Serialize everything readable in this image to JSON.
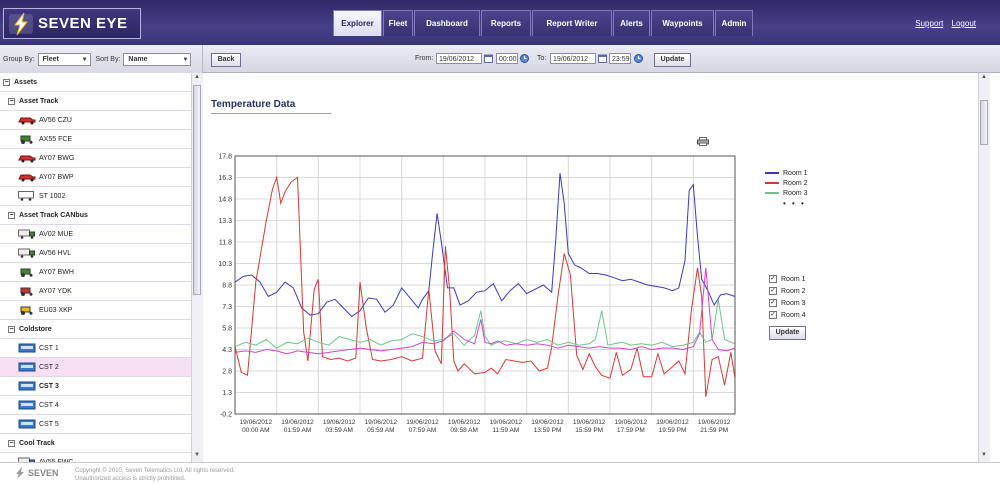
{
  "app": {
    "brand": "SEVEN EYE",
    "nav": [
      "Explorer",
      "Fleet",
      "Dashboard",
      "Reports",
      "Report Writer",
      "Alerts",
      "Waypoints",
      "Admin"
    ],
    "active_tab": "Explorer",
    "links": {
      "support": "Support",
      "logout": "Logout"
    }
  },
  "sidebar": {
    "group_by_label": "Group By:",
    "group_by_value": "Fleet",
    "sort_by_label": "Sort By:",
    "sort_by_value": "Name",
    "tree": [
      {
        "kind": "root",
        "label": "Assets"
      },
      {
        "kind": "group",
        "label": "Asset Track"
      },
      {
        "kind": "item",
        "label": "AV56 CZU",
        "icon": "red-car-icon"
      },
      {
        "kind": "item",
        "label": "AX55 FCE",
        "icon": "green-tractor-icon"
      },
      {
        "kind": "item",
        "label": "AY07 BWG",
        "icon": "red-car-icon"
      },
      {
        "kind": "item",
        "label": "AY07 BWP",
        "icon": "red-car-icon"
      },
      {
        "kind": "item",
        "label": "ST 1002",
        "icon": "trailer-icon"
      },
      {
        "kind": "group",
        "label": "Asset Track CANbus"
      },
      {
        "kind": "item",
        "label": "AV02 MUE",
        "icon": "green-truck-icon"
      },
      {
        "kind": "item",
        "label": "AV56 HVL",
        "icon": "green-truck-icon"
      },
      {
        "kind": "item",
        "label": "AY07 BWH",
        "icon": "green-tractor-icon"
      },
      {
        "kind": "item",
        "label": "AY07 YDK",
        "icon": "red-tractor-icon"
      },
      {
        "kind": "item",
        "label": "EU03 XKP",
        "icon": "yellow-digger-icon"
      },
      {
        "kind": "group",
        "label": "Coldstore"
      },
      {
        "kind": "item",
        "label": "CST 1",
        "icon": "coldstore-icon"
      },
      {
        "kind": "item",
        "label": "CST 2",
        "icon": "coldstore-icon",
        "selected": true
      },
      {
        "kind": "item",
        "label": "CST 3",
        "icon": "coldstore-icon",
        "bold": true
      },
      {
        "kind": "item",
        "label": "CST 4",
        "icon": "coldstore-icon"
      },
      {
        "kind": "item",
        "label": "CST 5",
        "icon": "coldstore-icon"
      },
      {
        "kind": "group",
        "label": "Cool Track"
      },
      {
        "kind": "item",
        "label": "AV55 FWC",
        "icon": "blue-truck-icon"
      }
    ]
  },
  "toolbar": {
    "back_label": "Back",
    "from_label": "From:",
    "from_date": "19/06/2012",
    "from_time": "00:00",
    "to_label": "To:",
    "to_date": "19/06/2012",
    "to_time": "23:59",
    "update_label": "Update"
  },
  "panel": {
    "title": "Temperature Data",
    "rooms": [
      {
        "label": "Room 1",
        "checked": true
      },
      {
        "label": "Room 2",
        "checked": true
      },
      {
        "label": "Room 3",
        "checked": true
      },
      {
        "label": "Room 4",
        "checked": true
      }
    ],
    "update_label": "Update",
    "legend_more": "• • •"
  },
  "chart_data": {
    "type": "line",
    "title": "",
    "xlabel": "",
    "ylabel": "",
    "ylim": [
      -0.2,
      17.8
    ],
    "yticks": [
      "17.8",
      "16.3",
      "14.8",
      "13.3",
      "11.8",
      "10.3",
      "8.8",
      "7.3",
      "5.8",
      "4.3",
      "2.8",
      "1.3",
      "-0.2"
    ],
    "xlim_hours": [
      0,
      24
    ],
    "x_tick_labels": [
      [
        "19/06/2012",
        "00:00 AM"
      ],
      [
        "19/06/2012",
        "01:59 AM"
      ],
      [
        "19/06/2012",
        "03:59 AM"
      ],
      [
        "19/06/2012",
        "05:59 AM"
      ],
      [
        "19/06/2012",
        "07:59 AM"
      ],
      [
        "19/06/2012",
        "09:58 AM"
      ],
      [
        "19/06/2012",
        "11:59 AM"
      ],
      [
        "19/06/2012",
        "13:59 PM"
      ],
      [
        "19/06/2012",
        "15:59 PM"
      ],
      [
        "19/06/2012",
        "17:59 PM"
      ],
      [
        "19/06/2012",
        "19:59 PM"
      ],
      [
        "19/06/2012",
        "21:59 PM"
      ]
    ],
    "grid": true,
    "legend_position": "right",
    "series": [
      {
        "name": "Room 1",
        "color": "#3b3bb8",
        "x": [
          0,
          0.4,
          0.8,
          1.2,
          1.6,
          2.0,
          2.4,
          2.8,
          3.2,
          3.6,
          4.0,
          4.4,
          4.8,
          5.2,
          5.6,
          6.0,
          6.4,
          6.8,
          7.2,
          7.6,
          8.0,
          8.4,
          8.8,
          9.0,
          9.3,
          9.5,
          9.7,
          9.9,
          10.2,
          10.5,
          10.8,
          11.2,
          11.6,
          12.0,
          12.4,
          12.8,
          13.2,
          13.6,
          14.0,
          14.4,
          14.8,
          15.2,
          15.4,
          15.6,
          15.8,
          16.0,
          16.3,
          16.6,
          17.0,
          17.4,
          17.8,
          18.2,
          18.6,
          19.0,
          19.4,
          19.8,
          20.2,
          20.6,
          21.0,
          21.3,
          21.6,
          21.8,
          22.0,
          22.2,
          22.4,
          22.7,
          23.0,
          23.3,
          23.6,
          24.0
        ],
        "y": [
          9.0,
          9.4,
          9.5,
          9.0,
          8.0,
          8.3,
          9.0,
          8.6,
          7.2,
          6.7,
          6.8,
          7.6,
          7.8,
          7.2,
          6.6,
          7.0,
          7.9,
          7.8,
          6.9,
          7.4,
          8.6,
          7.9,
          7.2,
          7.8,
          8.4,
          11.2,
          13.8,
          11.8,
          8.6,
          8.6,
          7.4,
          7.7,
          8.3,
          8.4,
          8.9,
          7.7,
          8.4,
          8.9,
          8.2,
          8.5,
          8.8,
          8.3,
          12.0,
          16.6,
          14.5,
          11.0,
          10.2,
          10.0,
          9.6,
          9.6,
          9.5,
          9.3,
          9.1,
          9.2,
          9.0,
          8.8,
          8.7,
          8.6,
          8.4,
          8.6,
          10.5,
          15.4,
          15.8,
          12.2,
          9.2,
          8.4,
          7.4,
          8.1,
          8.2,
          8.0
        ]
      },
      {
        "name": "Room 2",
        "color": "#d23a3a",
        "x": [
          0,
          0.3,
          0.6,
          1.0,
          1.5,
          1.8,
          2.0,
          2.2,
          2.4,
          2.7,
          3.0,
          3.3,
          3.5,
          3.8,
          4.0,
          4.2,
          4.6,
          5.0,
          5.4,
          5.8,
          6.0,
          6.3,
          6.6,
          7.0,
          7.5,
          8.0,
          8.5,
          9.0,
          9.3,
          9.6,
          9.9,
          10.1,
          10.3,
          10.5,
          10.7,
          11.0,
          11.5,
          12.0,
          12.3,
          12.6,
          13.0,
          13.4,
          13.8,
          14.2,
          14.6,
          15.0,
          15.2,
          15.5,
          15.8,
          16.1,
          16.4,
          16.7,
          17.0,
          17.3,
          17.6,
          18.0,
          18.3,
          18.6,
          19.0,
          19.3,
          19.6,
          20.0,
          20.3,
          20.6,
          21.0,
          21.3,
          21.6,
          21.9,
          22.2,
          22.4,
          22.6,
          22.9,
          23.2,
          23.5,
          23.8,
          24.0
        ],
        "y": [
          4.5,
          2.7,
          2.5,
          9.0,
          13.3,
          15.5,
          16.3,
          14.5,
          15.3,
          16.0,
          16.3,
          5.5,
          3.5,
          8.5,
          9.2,
          3.8,
          3.6,
          3.7,
          3.5,
          3.7,
          9.0,
          5.8,
          3.6,
          3.5,
          3.6,
          3.8,
          3.5,
          3.7,
          8.5,
          4.2,
          3.3,
          11.5,
          8.5,
          3.5,
          2.8,
          3.3,
          2.6,
          2.7,
          3.0,
          2.6,
          3.6,
          3.5,
          3.4,
          3.5,
          2.8,
          3.0,
          4.5,
          8.0,
          11.0,
          9.5,
          3.9,
          2.9,
          4.0,
          3.1,
          2.5,
          2.3,
          4.1,
          2.5,
          2.9,
          4.4,
          2.4,
          2.4,
          4.0,
          2.6,
          3.1,
          3.5,
          2.6,
          7.0,
          10.0,
          8.0,
          1.0,
          3.6,
          3.8,
          1.8,
          4.1,
          2.3
        ]
      },
      {
        "name": "Room 3",
        "color": "#6cc48a",
        "x": [
          0,
          0.5,
          1.0,
          1.5,
          2.0,
          2.5,
          3.0,
          3.5,
          4.0,
          4.5,
          5.0,
          5.5,
          6.0,
          6.5,
          7.0,
          7.5,
          8.0,
          8.5,
          9.0,
          9.5,
          10.0,
          10.5,
          11.0,
          11.5,
          11.8,
          12.0,
          12.3,
          12.6,
          13.0,
          13.5,
          14.0,
          14.5,
          15.0,
          15.5,
          16.0,
          16.5,
          17.0,
          17.3,
          17.6,
          17.9,
          18.2,
          18.6,
          19.0,
          19.5,
          20.0,
          20.5,
          21.0,
          21.5,
          22.0,
          22.3,
          22.6,
          22.9,
          23.2,
          23.5,
          24.0
        ],
        "y": [
          4.5,
          4.8,
          4.6,
          5.0,
          4.4,
          4.8,
          4.7,
          5.1,
          4.8,
          4.6,
          5.2,
          5.0,
          4.8,
          5.0,
          4.6,
          4.9,
          5.0,
          5.4,
          5.2,
          4.9,
          5.0,
          5.4,
          4.6,
          5.3,
          7.0,
          5.2,
          4.6,
          4.8,
          4.9,
          4.7,
          5.0,
          4.8,
          5.0,
          4.6,
          4.8,
          4.6,
          4.7,
          5.0,
          7.0,
          4.6,
          4.7,
          4.8,
          4.6,
          4.7,
          4.6,
          4.8,
          4.5,
          4.6,
          4.8,
          5.5,
          4.8,
          5.0,
          7.8,
          5.0,
          4.7
        ]
      },
      {
        "name": "Room 4",
        "color": "#d046c4",
        "x": [
          0,
          0.5,
          1.0,
          1.5,
          2.0,
          2.5,
          3.0,
          3.5,
          4.0,
          4.5,
          5.0,
          5.5,
          6.0,
          6.5,
          7.0,
          7.5,
          8.0,
          8.5,
          9.0,
          9.5,
          10.0,
          10.5,
          11.0,
          11.5,
          11.8,
          12.0,
          12.3,
          12.6,
          13.0,
          13.5,
          14.0,
          14.5,
          15.0,
          15.5,
          16.0,
          16.5,
          17.0,
          17.5,
          18.0,
          18.5,
          19.0,
          19.5,
          20.0,
          20.5,
          21.0,
          21.5,
          22.0,
          22.3,
          22.6,
          22.9,
          23.2,
          23.6,
          24.0
        ],
        "y": [
          4.1,
          4.2,
          4.1,
          4.3,
          4.2,
          4.0,
          4.2,
          4.1,
          4.0,
          4.1,
          4.2,
          4.3,
          4.4,
          4.3,
          4.2,
          4.3,
          4.4,
          4.5,
          4.8,
          4.7,
          4.9,
          5.6,
          5.0,
          4.7,
          6.4,
          4.8,
          4.7,
          4.9,
          4.6,
          4.7,
          4.6,
          4.7,
          4.6,
          4.4,
          4.6,
          4.5,
          4.4,
          4.5,
          4.4,
          4.4,
          4.3,
          4.5,
          4.3,
          4.4,
          4.4,
          4.3,
          4.5,
          5.4,
          10.0,
          5.0,
          4.3,
          4.2,
          4.4
        ]
      }
    ]
  },
  "footer": {
    "logo_text": "SEVEN",
    "copyright": "Copyright © 2010, Seven Telematics Ltd. All rights reserved.",
    "warning": "Unauthorized access is strictly prohibited."
  }
}
